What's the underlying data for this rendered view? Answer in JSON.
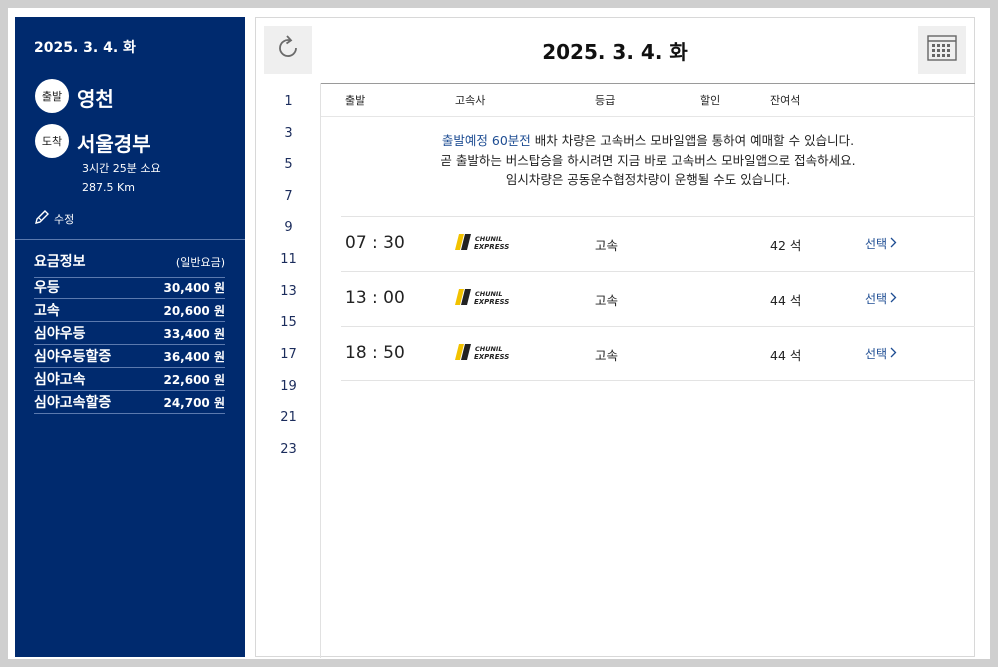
{
  "sidebar": {
    "date": "2025. 3. 4. 화",
    "departure_badge": "출발",
    "departure": "영천",
    "arrival_badge": "도착",
    "arrival": "서울경부",
    "duration": "3시간 25분 소요",
    "distance": "287.5 Km",
    "edit_label": "수정",
    "fare_title": "요금정보",
    "fare_subtitle": "(일반요금)",
    "fares": [
      {
        "name": "우등",
        "price": "30,400 원"
      },
      {
        "name": "고속",
        "price": "20,600 원"
      },
      {
        "name": "심야우등",
        "price": "33,400 원"
      },
      {
        "name": "심야우등할증",
        "price": "36,400 원"
      },
      {
        "name": "심야고속",
        "price": "22,600 원"
      },
      {
        "name": "심야고속할증",
        "price": "24,700 원"
      }
    ]
  },
  "main": {
    "title": "2025. 3. 4. 화",
    "hours": [
      "1",
      "3",
      "5",
      "7",
      "9",
      "11",
      "13",
      "15",
      "17",
      "19",
      "21",
      "23"
    ],
    "columns": {
      "departure": "출발",
      "company": "고속사",
      "grade": "등급",
      "discount": "할인",
      "seats": "잔여석"
    },
    "notice": {
      "line1_em": "출발예정 60분전",
      "line1_rest": " 배차 차량은 고속버스 모바일앱을 통하여 예매할 수 있습니다.",
      "line2": "곧 출발하는 버스탑승을 하시려면 지금 바로 고속버스 모바일앱으로 접속하세요.",
      "line3": "임시차량은 공동운수협정차량이 운행될 수도 있습니다."
    },
    "logo_text": {
      "line1": "CHUNIL",
      "line2": "EXPRESS"
    },
    "schedules": [
      {
        "time": "07 : 30",
        "grade": "고속",
        "seats": "42 석",
        "select": "선택"
      },
      {
        "time": "13 : 00",
        "grade": "고속",
        "seats": "44 석",
        "select": "선택"
      },
      {
        "time": "18 : 50",
        "grade": "고속",
        "seats": "44 석",
        "select": "선택"
      }
    ]
  },
  "colors": {
    "sidebar_bg": "#002a6e",
    "accent": "#1e4d93",
    "logo_yellow": "#f2c200"
  },
  "icons": {
    "refresh": "refresh-icon",
    "calendar": "calendar-icon",
    "edit": "pencil-icon",
    "chevron": "chevron-right-icon"
  }
}
